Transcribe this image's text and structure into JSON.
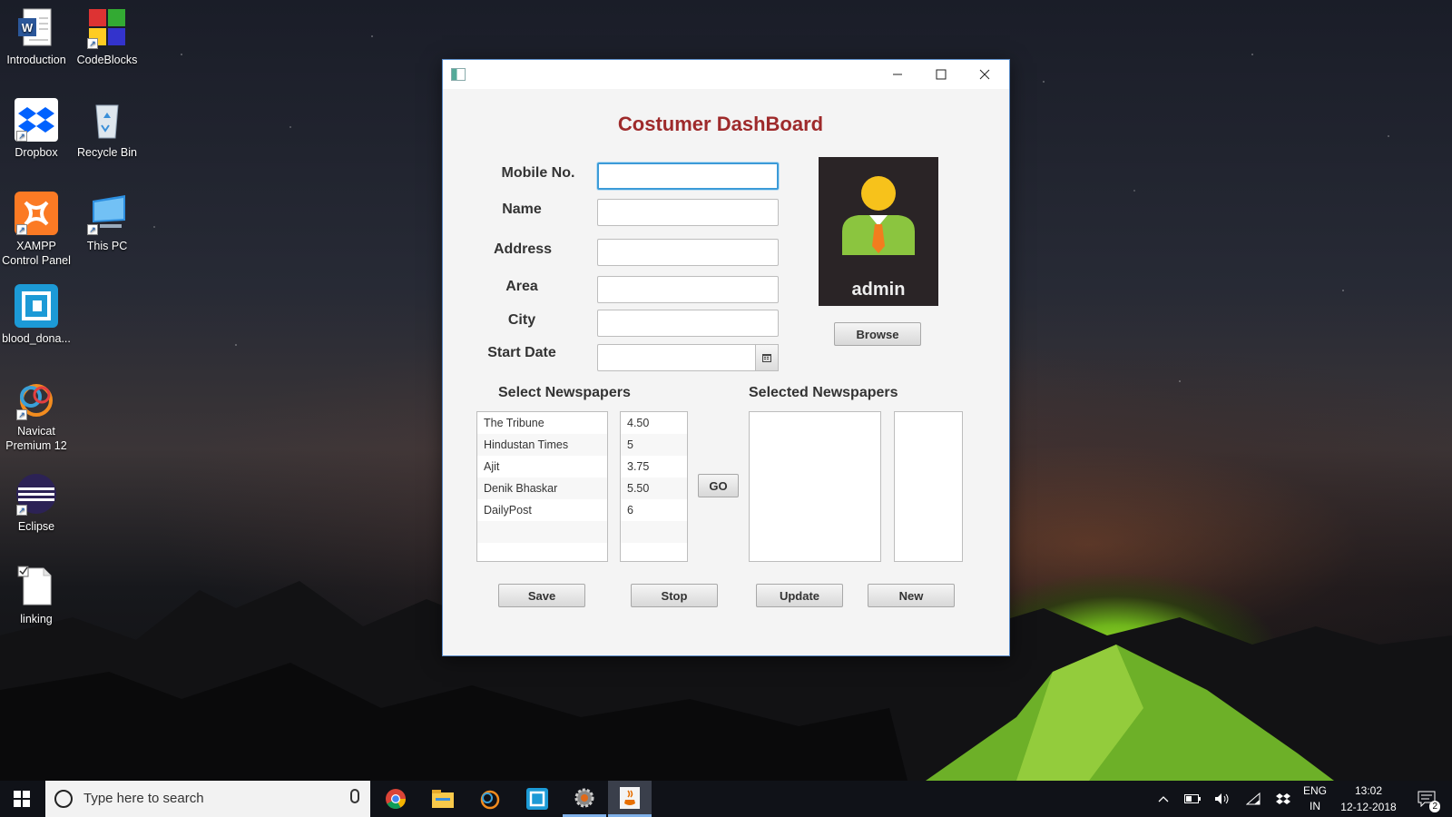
{
  "desktop": {
    "icons": [
      {
        "label": "Introduction"
      },
      {
        "label": "CodeBlocks"
      },
      {
        "label": "Dropbox"
      },
      {
        "label": "Recycle Bin"
      },
      {
        "label": "XAMPP Control Panel"
      },
      {
        "label": "This PC"
      },
      {
        "label": "blood_dona..."
      },
      {
        "label": "Navicat Premium 12"
      },
      {
        "label": "Eclipse"
      },
      {
        "label": "linking"
      }
    ]
  },
  "window": {
    "title": "Costumer DashBoard",
    "fields": {
      "mobile": {
        "label": "Mobile No.",
        "value": ""
      },
      "name": {
        "label": "Name",
        "value": ""
      },
      "address": {
        "label": "Address",
        "value": ""
      },
      "area": {
        "label": "Area",
        "value": ""
      },
      "city": {
        "label": "City",
        "value": ""
      },
      "start_date": {
        "label": "Start Date",
        "value": ""
      }
    },
    "avatar": {
      "name": "admin"
    },
    "browse_label": "Browse",
    "select_section": "Select Newspapers",
    "selected_section": "Selected Newspapers",
    "newspapers": [
      {
        "name": "The Tribune",
        "price": "4.50"
      },
      {
        "name": "Hindustan Times",
        "price": "5"
      },
      {
        "name": "Ajit",
        "price": "3.75"
      },
      {
        "name": "Denik Bhaskar",
        "price": "5.50"
      },
      {
        "name": "DailyPost",
        "price": "6"
      }
    ],
    "go_label": "GO",
    "buttons": {
      "save": "Save",
      "stop": "Stop",
      "update": "Update",
      "new": "New"
    }
  },
  "taskbar": {
    "search_placeholder": "Type here to search",
    "lang": "ENG",
    "region": "IN",
    "time": "13:02",
    "date": "12-12-2018",
    "notification_count": "2"
  }
}
